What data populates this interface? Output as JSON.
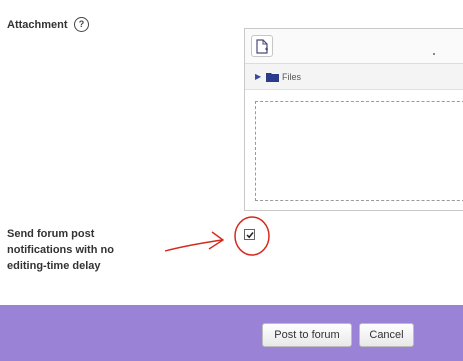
{
  "attachment": {
    "label": "Attachment",
    "help_glyph": "?",
    "help_icon": "question-circle-icon"
  },
  "filemanager": {
    "add_icon": "add-file-icon",
    "path_arrow_glyph": "▶",
    "folder_icon": "folder-icon",
    "path_label": "Files"
  },
  "notification": {
    "label": "Send forum post notifications with no editing-time delay",
    "checked": true
  },
  "annotation": {
    "color": "#d42a1f"
  },
  "footer": {
    "background": "#9a82d6",
    "post_label": "Post to forum",
    "cancel_label": "Cancel"
  }
}
